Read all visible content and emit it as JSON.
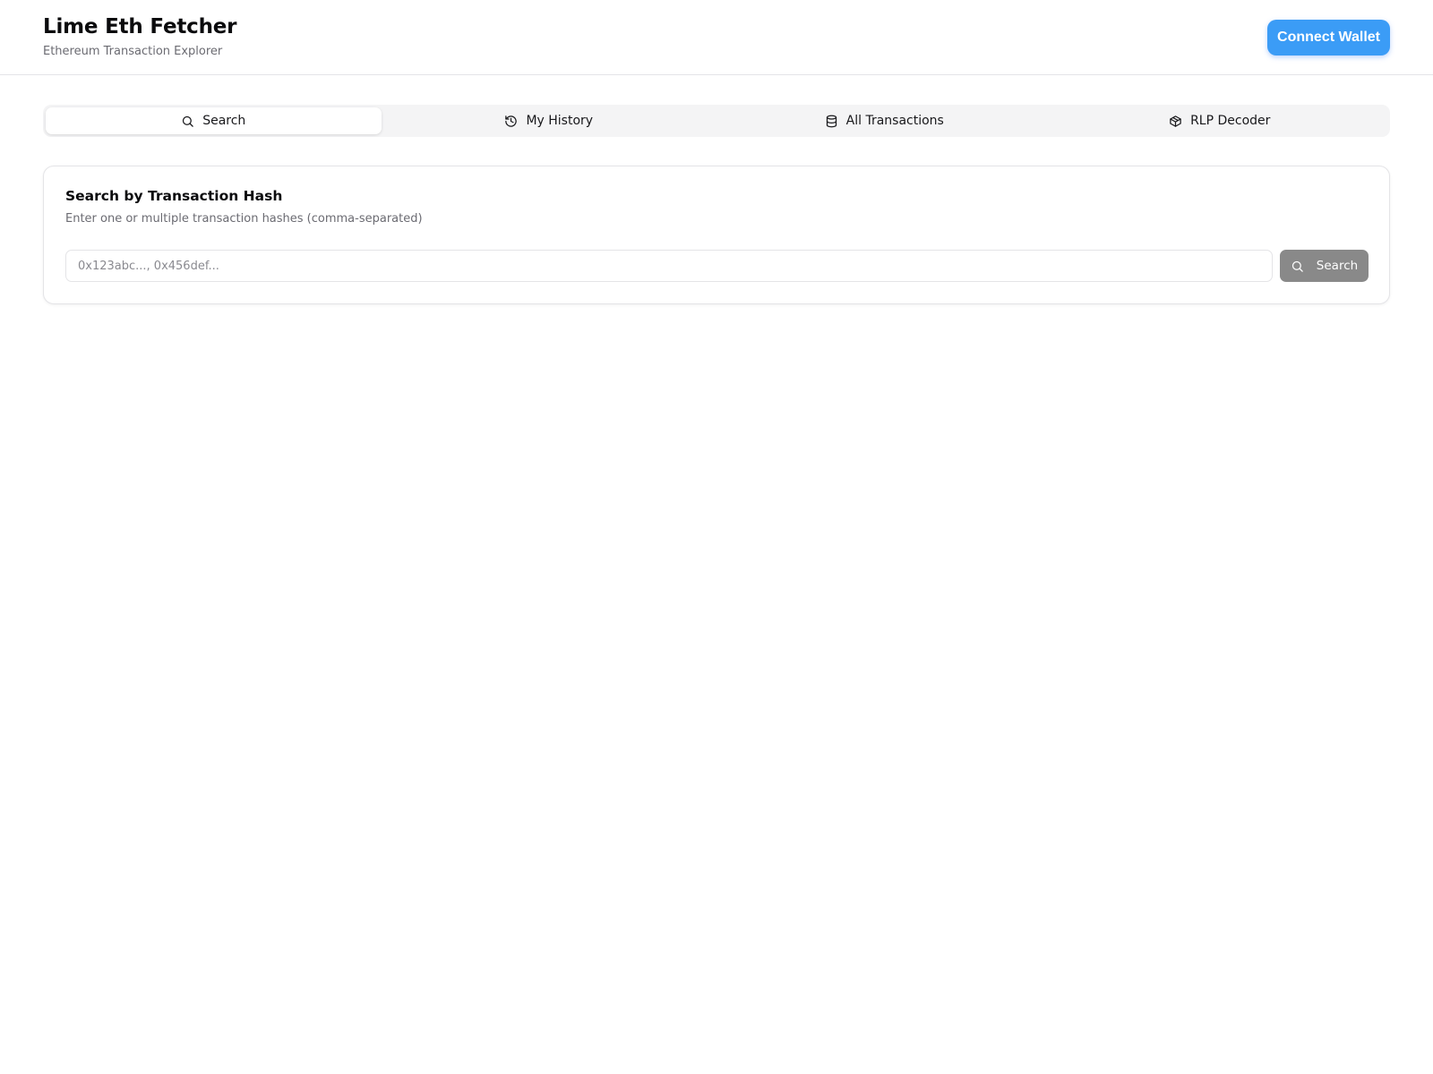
{
  "header": {
    "title": "Lime Eth Fetcher",
    "subtitle": "Ethereum Transaction Explorer",
    "connect_label": "Connect Wallet"
  },
  "tabs": [
    {
      "label": "Search",
      "icon": "search-icon",
      "active": true
    },
    {
      "label": "My History",
      "icon": "history-icon",
      "active": false
    },
    {
      "label": "All Transactions",
      "icon": "database-icon",
      "active": false
    },
    {
      "label": "RLP Decoder",
      "icon": "package-icon",
      "active": false
    }
  ],
  "search_card": {
    "title": "Search by Transaction Hash",
    "description": "Enter one or multiple transaction hashes (comma-separated)",
    "input_value": "",
    "input_placeholder": "0x123abc..., 0x456def...",
    "button_label": "Search"
  },
  "colors": {
    "accent": "#3b9cf6",
    "search_button": "#898989",
    "border": "#e4e4e7",
    "muted_text": "#6b6b72"
  }
}
